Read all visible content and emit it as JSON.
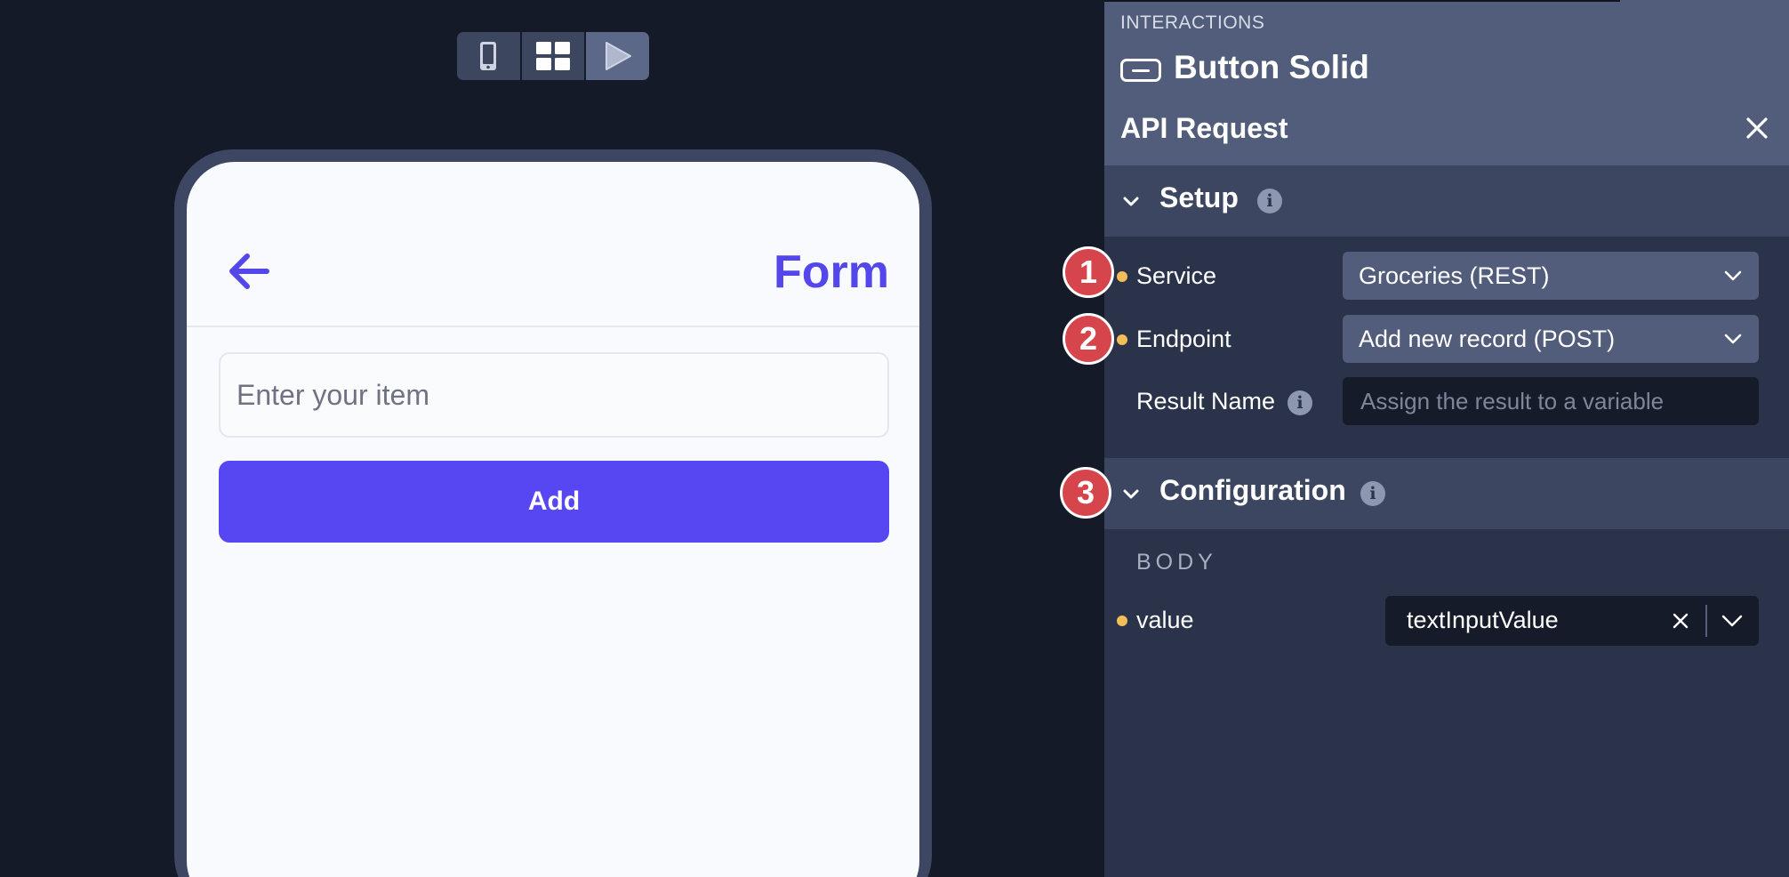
{
  "toolbar": {
    "buttons": [
      {
        "icon": "mobile-device-icon",
        "active": false
      },
      {
        "icon": "grid-layout-icon",
        "active": false
      },
      {
        "icon": "play-icon",
        "active": true
      }
    ]
  },
  "preview": {
    "back_icon": "arrow-left-icon",
    "header_title": "Form",
    "input_placeholder": "Enter your item",
    "add_button_label": "Add",
    "accent_color": "#5647f2"
  },
  "panel": {
    "section_label": "INTERACTIONS",
    "component_icon": "button-component-icon",
    "component_name": "Button Solid",
    "action_title": "API Request",
    "setup": {
      "title": "Setup",
      "fields": {
        "service": {
          "label": "Service",
          "value": "Groceries (REST)",
          "required": true
        },
        "endpoint": {
          "label": "Endpoint",
          "value": "Add new record (POST)",
          "required": true
        },
        "result_name": {
          "label": "Result Name",
          "placeholder": "Assign the result to a variable",
          "required": false
        }
      }
    },
    "configuration": {
      "title": "Configuration",
      "body_label": "BODY",
      "value_field": {
        "label": "value",
        "variable": "textInputValue",
        "required": true
      }
    }
  },
  "badges": [
    "1",
    "2",
    "3"
  ],
  "colors": {
    "background": "#151a29",
    "panel": "#2a334a",
    "panel_header": "#525d7b",
    "badge": "#d5454b",
    "required_dot": "#f3bd5a"
  }
}
